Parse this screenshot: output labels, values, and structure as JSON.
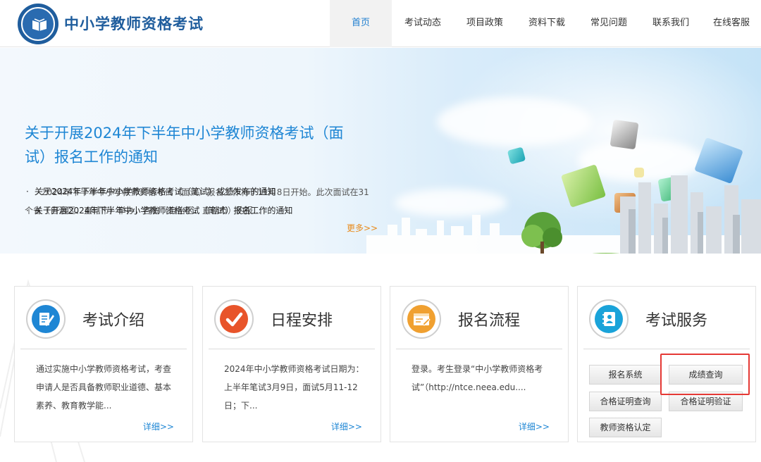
{
  "site": {
    "title": "中小学教师资格考试"
  },
  "nav": [
    {
      "label": "首页",
      "active": true
    },
    {
      "label": "考试动态",
      "active": false
    },
    {
      "label": "项目政策",
      "active": false
    },
    {
      "label": "资料下载",
      "active": false
    },
    {
      "label": "常见问题",
      "active": false
    },
    {
      "label": "联系我们",
      "active": false
    },
    {
      "label": "在线客服",
      "active": false
    }
  ],
  "banner": {
    "title": "关于开展2024年下半年中小学教师资格考试（面试）报名工作的通知",
    "desc": "2024年下半年中小学教师资格考试（面试）报名工作将于11月8日开始。此次面试在31个省（自治区、直辖市）举办，各省（自治区、直辖市）的报...",
    "links": [
      "关于2024年下半年中小学教师资格考试（笔试）成绩发布的通知",
      "关于开展2024年下半年中小学教师资格考试（笔试）报名工作的通知"
    ],
    "more": "更多>>"
  },
  "cards": [
    {
      "title": "考试介绍",
      "text": "通过实施中小学教师资格考试，考查申请人是否具备教师职业道德、基本素养、教育教学能...",
      "more": "详细>>",
      "icon": "document-pen-icon",
      "color": "#1e86d4"
    },
    {
      "title": "日程安排",
      "text": "2024年中小学教师资格考试日期为：上半年笔试3月9日，面试5月11-12日；下...",
      "more": "详细>>",
      "icon": "checkmark-icon",
      "color": "#e8542a"
    },
    {
      "title": "报名流程",
      "text": "登录。考生登录“中小学教师资格考试”（http://ntce.neea.edu....",
      "more": "详细>>",
      "icon": "registration-form-icon",
      "color": "#f0a030"
    },
    {
      "title": "考试服务",
      "icon": "address-book-icon",
      "color": "#1aa3d9",
      "buttons": [
        "报名系统",
        "成绩查询",
        "合格证明查询",
        "合格证明验证",
        "教师资格认定"
      ]
    }
  ]
}
